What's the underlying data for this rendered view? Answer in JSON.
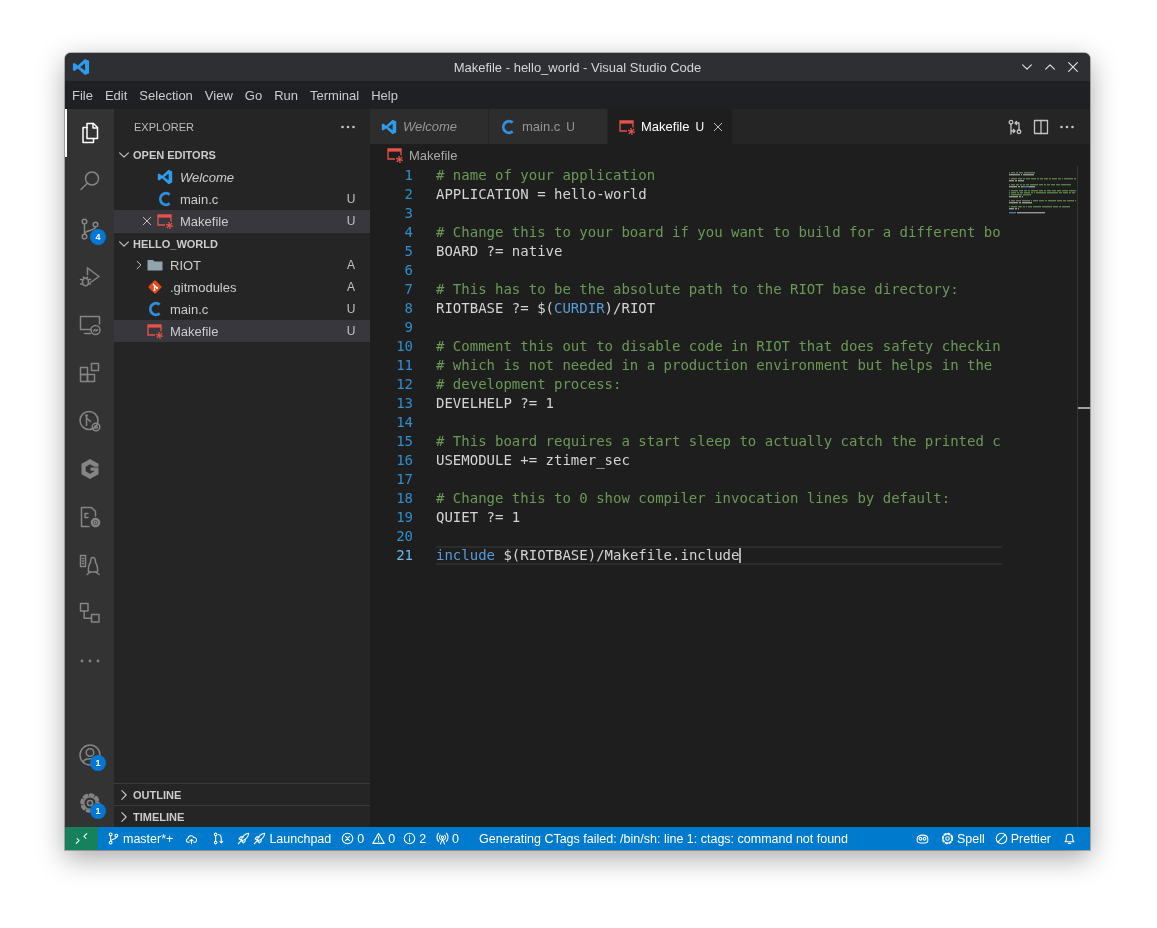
{
  "window": {
    "title": "Makefile - hello_world - Visual Studio Code"
  },
  "menu": [
    "File",
    "Edit",
    "Selection",
    "View",
    "Go",
    "Run",
    "Terminal",
    "Help"
  ],
  "activity_bar": {
    "items": [
      {
        "selected": true
      },
      {
        "selected": false
      },
      {
        "selected": false,
        "badge": "4"
      },
      {
        "selected": false
      },
      {
        "selected": false
      },
      {
        "selected": false
      },
      {
        "selected": false
      },
      {
        "selected": false
      },
      {
        "selected": false
      },
      {
        "selected": false
      },
      {
        "selected": false
      },
      {
        "selected": false
      }
    ],
    "bottom": [
      {
        "badge": "1"
      },
      {
        "badge": "1"
      }
    ]
  },
  "sidebar": {
    "title": "EXPLORER",
    "open_editors": {
      "title": "OPEN EDITORS",
      "expanded": true,
      "items": [
        {
          "name": "Welcome",
          "kind": "welcome",
          "preview": true,
          "selected": false
        },
        {
          "name": "main.c",
          "kind": "csource",
          "preview": false,
          "selected": false,
          "status": "U"
        },
        {
          "name": "Makefile",
          "kind": "makefile",
          "preview": false,
          "selected": true,
          "status": "U"
        }
      ]
    },
    "folder": {
      "title": "HELLO_WORLD",
      "expanded": true,
      "items": [
        {
          "name": "RIOT",
          "kind": "folder",
          "expanded": false,
          "selected": false,
          "status": "A"
        },
        {
          "name": ".gitmodules",
          "kind": "gitconfig",
          "selected": false,
          "status": "A"
        },
        {
          "name": "main.c",
          "kind": "csource",
          "selected": false,
          "status": "U"
        },
        {
          "name": "Makefile",
          "kind": "makefile",
          "selected": true,
          "status": "U"
        }
      ]
    },
    "panels": [
      {
        "title": "OUTLINE",
        "expanded": false
      },
      {
        "title": "TIMELINE",
        "expanded": false
      }
    ]
  },
  "editor": {
    "tabs": [
      {
        "label": "Welcome",
        "kind": "welcome",
        "preview": true,
        "selected": false
      },
      {
        "label": "main.c",
        "kind": "csource",
        "preview": false,
        "selected": false,
        "status": "U"
      },
      {
        "label": "Makefile",
        "kind": "makefile",
        "preview": false,
        "selected": true,
        "status": "U"
      }
    ],
    "breadcrumb": [
      {
        "label": "Makefile",
        "kind": "makefile"
      }
    ],
    "lines": [
      {
        "number": "1",
        "current": false,
        "tokens": [
          {
            "kind": "comment",
            "text": "# name of your application"
          }
        ]
      },
      {
        "number": "2",
        "current": false,
        "tokens": [
          {
            "kind": "plain",
            "text": "APPLICATION = hello-world"
          }
        ]
      },
      {
        "number": "3",
        "current": false
      },
      {
        "number": "4",
        "current": false,
        "tokens": [
          {
            "kind": "comment",
            "text": "# Change this to your board if you want to build for a different bo"
          }
        ]
      },
      {
        "number": "5",
        "current": false,
        "tokens": [
          {
            "kind": "plain",
            "text": "BOARD ?= native"
          }
        ]
      },
      {
        "number": "6",
        "current": false
      },
      {
        "number": "7",
        "current": false,
        "tokens": [
          {
            "kind": "comment",
            "text": "# This has to be the absolute path to the RIOT base directory:"
          }
        ]
      },
      {
        "number": "8",
        "current": false,
        "tokens": [
          {
            "kind": "plain",
            "text": "RIOTBASE ?= $("
          },
          {
            "kind": "keyword",
            "text": "CURDIR"
          },
          {
            "kind": "plain",
            "text": ")/RIOT"
          }
        ]
      },
      {
        "number": "9",
        "current": false
      },
      {
        "number": "10",
        "current": false,
        "tokens": [
          {
            "kind": "comment",
            "text": "# Comment this out to disable code in RIOT that does safety checkin"
          }
        ]
      },
      {
        "number": "11",
        "current": false,
        "tokens": [
          {
            "kind": "comment",
            "text": "# which is not needed in a production environment but helps in the"
          }
        ]
      },
      {
        "number": "12",
        "current": false,
        "tokens": [
          {
            "kind": "comment",
            "text": "# development process:"
          }
        ]
      },
      {
        "number": "13",
        "current": false,
        "tokens": [
          {
            "kind": "plain",
            "text": "DEVELHELP ?= 1"
          }
        ]
      },
      {
        "number": "14",
        "current": false
      },
      {
        "number": "15",
        "current": false,
        "tokens": [
          {
            "kind": "comment",
            "text": "# This board requires a start sleep to actually catch the printed c"
          }
        ]
      },
      {
        "number": "16",
        "current": false,
        "tokens": [
          {
            "kind": "plain",
            "text": "USEMODULE += ztimer_sec"
          }
        ]
      },
      {
        "number": "17",
        "current": false
      },
      {
        "number": "18",
        "current": false,
        "tokens": [
          {
            "kind": "comment",
            "text": "# Change this to 0 show compiler invocation lines by default:"
          }
        ]
      },
      {
        "number": "19",
        "current": false,
        "tokens": [
          {
            "kind": "plain",
            "text": "QUIET ?= 1"
          }
        ]
      },
      {
        "number": "20",
        "current": false
      },
      {
        "number": "21",
        "current": true,
        "tokens": [
          {
            "kind": "keyword",
            "text": "include"
          },
          {
            "kind": "plain",
            "text": " $(RIOTBASE)/Makefile.include"
          }
        ]
      }
    ]
  },
  "status_bar": {
    "branch": "master*+",
    "launchpad": "Launchpad",
    "errors": "0",
    "warnings": "0",
    "infos": "2",
    "ports": "0",
    "message": "Generating CTags failed: /bin/sh: line 1: ctags: command not found",
    "spell": "Spell",
    "prettier": "Prettier"
  }
}
